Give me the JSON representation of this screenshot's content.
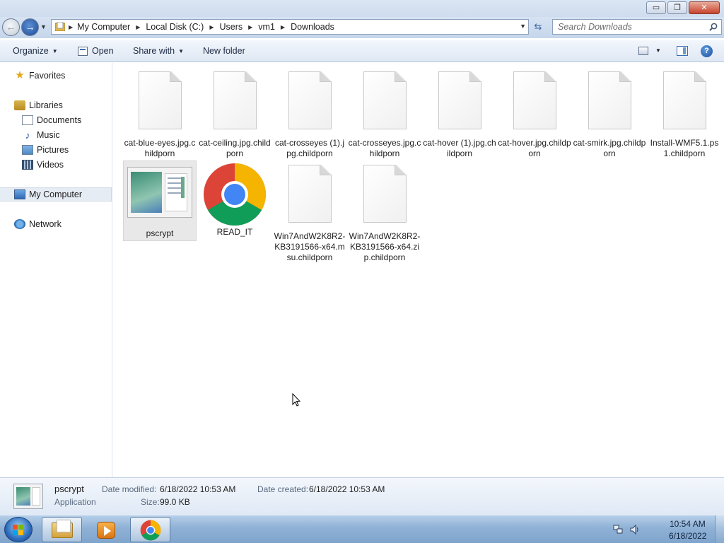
{
  "window": {
    "buttons": {
      "minimize": "▭",
      "maximize": "❐",
      "close": "✕"
    }
  },
  "address": {
    "breadcrumbs": [
      "My Computer",
      "Local Disk (C:)",
      "Users",
      "vm1",
      "Downloads"
    ]
  },
  "search": {
    "placeholder": "Search Downloads"
  },
  "toolbar": {
    "organize": "Organize",
    "open": "Open",
    "share_with": "Share with",
    "new_folder": "New folder"
  },
  "nav": {
    "favorites": "Favorites",
    "libraries": "Libraries",
    "documents": "Documents",
    "music": "Music",
    "pictures": "Pictures",
    "videos": "Videos",
    "my_computer": "My Computer",
    "network": "Network"
  },
  "files": [
    {
      "label": "cat-blue-eyes.jpg.childporn",
      "type": "doc"
    },
    {
      "label": "cat-ceiling.jpg.childporn",
      "type": "doc"
    },
    {
      "label": "cat-crosseyes (1).jpg.childporn",
      "type": "doc"
    },
    {
      "label": "cat-crosseyes.jpg.childporn",
      "type": "doc"
    },
    {
      "label": "cat-hover (1).jpg.childporn",
      "type": "doc"
    },
    {
      "label": "cat-hover.jpg.childporn",
      "type": "doc"
    },
    {
      "label": "cat-smirk.jpg.childporn",
      "type": "doc"
    },
    {
      "label": "Install-WMF5.1.ps1.childporn",
      "type": "doc"
    },
    {
      "label": "pscrypt",
      "type": "application",
      "selected": true
    },
    {
      "label": "READ_IT",
      "type": "chrome-html"
    },
    {
      "label": "Win7AndW2K8R2-KB3191566-x64.msu.childporn",
      "type": "doc"
    },
    {
      "label": "Win7AndW2K8R2-KB3191566-x64.zip.childporn",
      "type": "doc"
    }
  ],
  "details": {
    "name": "pscrypt",
    "type": "Application",
    "date_modified_label": "Date modified:",
    "date_modified": "6/18/2022 10:53 AM",
    "date_created_label": "Date created:",
    "date_created": "6/18/2022 10:53 AM",
    "size_label": "Size:",
    "size": "99.0 KB"
  },
  "taskbar": {
    "time": "10:54 AM",
    "date": "6/18/2022"
  },
  "colors": {
    "chrome_red": "#db4437",
    "chrome_green": "#0f9d58",
    "chrome_yellow": "#f4b400",
    "chrome_blue": "#4285f4"
  }
}
